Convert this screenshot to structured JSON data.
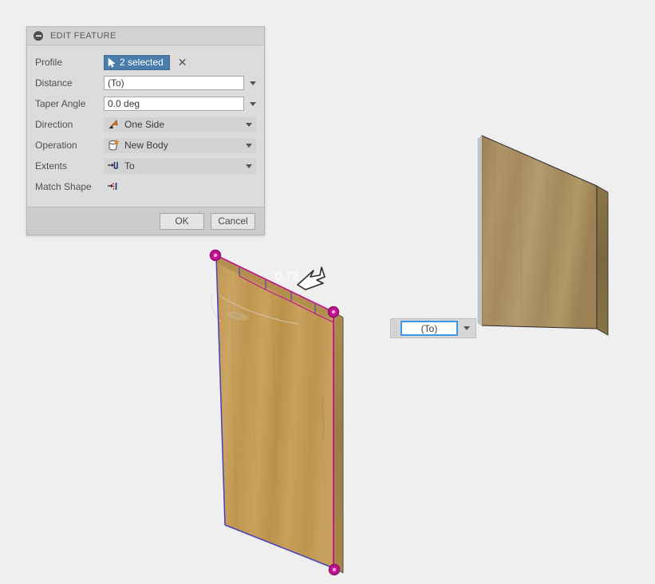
{
  "app": {
    "canvas_bg": "#efefef",
    "accent_blue": "#4a7dab",
    "highlight_blue": "#3c99e8",
    "selection_magenta": "#c0138f",
    "sketch_edge_blue": "#4a43b8",
    "wood_light": "#c59b4e",
    "wood_dark": "#9a7d48"
  },
  "dialog": {
    "title": "EDIT FEATURE",
    "collapse_icon": "collapse-circle-minus-icon",
    "rows": [
      {
        "label": "Profile",
        "control": "selection",
        "value": "2 selected",
        "icon": "cursor-arrow-icon",
        "clear_icon": "close-x-icon"
      },
      {
        "label": "Distance",
        "control": "text-dropdown",
        "value": "(To)",
        "placeholder": "(To)"
      },
      {
        "label": "Taper Angle",
        "control": "text-dropdown",
        "value": "0.0 deg",
        "placeholder": "0.0 deg"
      },
      {
        "label": "Direction",
        "control": "combo",
        "value": "One Side",
        "icon": "one-side-arrow-icon"
      },
      {
        "label": "Operation",
        "control": "combo",
        "value": "New Body",
        "icon": "new-body-cylinder-icon"
      },
      {
        "label": "Extents",
        "control": "combo",
        "value": "To",
        "icon": "extents-to-icon"
      },
      {
        "label": "Match Shape",
        "control": "icon-only",
        "value": "",
        "icon": "match-shape-icon"
      }
    ],
    "footer": {
      "ok_label": "OK",
      "cancel_label": "Cancel"
    }
  },
  "floating_input": {
    "grip_icon": "drag-grip-icon",
    "value": "(To)",
    "placeholder": "(To)",
    "caret_icon": "chevron-down-icon"
  },
  "canvas": {
    "dimension_label": "0.72",
    "cursor_icon": "mouse-pointer-icon",
    "bodies": [
      {
        "name": "extruded-profile-board",
        "state": "selected",
        "edge_color": "#c0138f"
      },
      {
        "name": "target-board",
        "state": "normal",
        "edge_color": "#2b2b2b"
      }
    ]
  }
}
